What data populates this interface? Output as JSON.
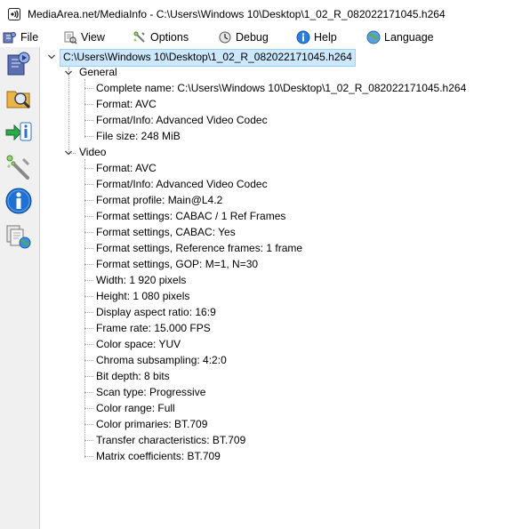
{
  "window": {
    "title": "MediaArea.net/MediaInfo - C:\\Users\\Windows 10\\Desktop\\1_02_R_082022171045.h264"
  },
  "menu": {
    "file": "File",
    "view": "View",
    "options": "Options",
    "debug": "Debug",
    "help": "Help",
    "language": "Language"
  },
  "sidebar": {
    "buttons": [
      {
        "icon": "media-file-icon"
      },
      {
        "icon": "folder-search-icon"
      },
      {
        "icon": "export-info-icon"
      },
      {
        "icon": "wrench-options-icon"
      },
      {
        "icon": "info-icon"
      },
      {
        "icon": "documents-web-icon"
      }
    ]
  },
  "tree": {
    "root": "C:\\Users\\Windows 10\\Desktop\\1_02_R_082022171045.h264",
    "general": {
      "label": "General",
      "items": [
        "Complete name: C:\\Users\\Windows 10\\Desktop\\1_02_R_082022171045.h264",
        "Format: AVC",
        "Format/Info: Advanced Video Codec",
        "File size: 248 MiB"
      ]
    },
    "video": {
      "label": "Video",
      "items": [
        "Format: AVC",
        "Format/Info: Advanced Video Codec",
        "Format profile: Main@L4.2",
        "Format settings: CABAC / 1 Ref Frames",
        "Format settings, CABAC: Yes",
        "Format settings, Reference frames: 1 frame",
        "Format settings, GOP: M=1, N=30",
        "Width: 1 920 pixels",
        "Height: 1 080 pixels",
        "Display aspect ratio: 16:9",
        "Frame rate: 15.000 FPS",
        "Color space: YUV",
        "Chroma subsampling: 4:2:0",
        "Bit depth: 8 bits",
        "Scan type: Progressive",
        "Color range: Full",
        "Color primaries: BT.709",
        "Transfer characteristics: BT.709",
        "Matrix coefficients: BT.709"
      ]
    }
  }
}
